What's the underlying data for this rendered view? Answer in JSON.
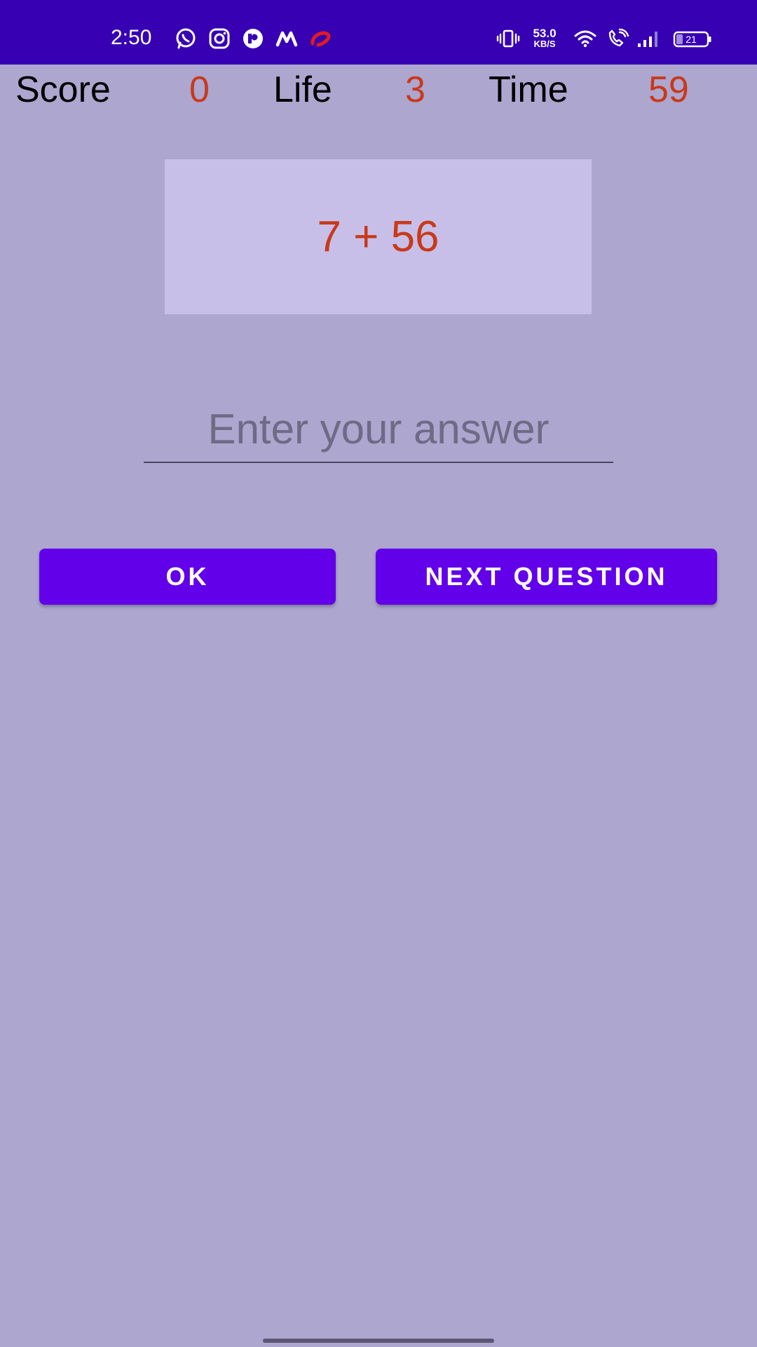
{
  "status_bar": {
    "time": "2:50",
    "net_speed_value": "53.0",
    "net_speed_unit": "KB/S",
    "battery_level": "21",
    "color": "#3700b3",
    "left_icons": [
      "whatsapp-icon",
      "instagram-icon",
      "circle-app-icon",
      "m-app-icon",
      "airtel-icon"
    ],
    "right_icons": [
      "vibrate-icon",
      "wifi-icon",
      "wifi-call-icon",
      "signal-icon",
      "battery-icon"
    ]
  },
  "stats": {
    "score_label": "Score",
    "score_value": "0",
    "life_label": "Life",
    "life_value": "3",
    "time_label": "Time",
    "time_value": "59"
  },
  "question": {
    "text": "7 + 56"
  },
  "answer": {
    "value": "",
    "placeholder": "Enter your answer"
  },
  "buttons": {
    "ok_label": "OK",
    "next_label": "NEXT QUESTION"
  },
  "colors": {
    "background": "#ada6cf",
    "question_box": "#c7bfe8",
    "accent": "#6200ea",
    "value_text": "#c8391a"
  }
}
